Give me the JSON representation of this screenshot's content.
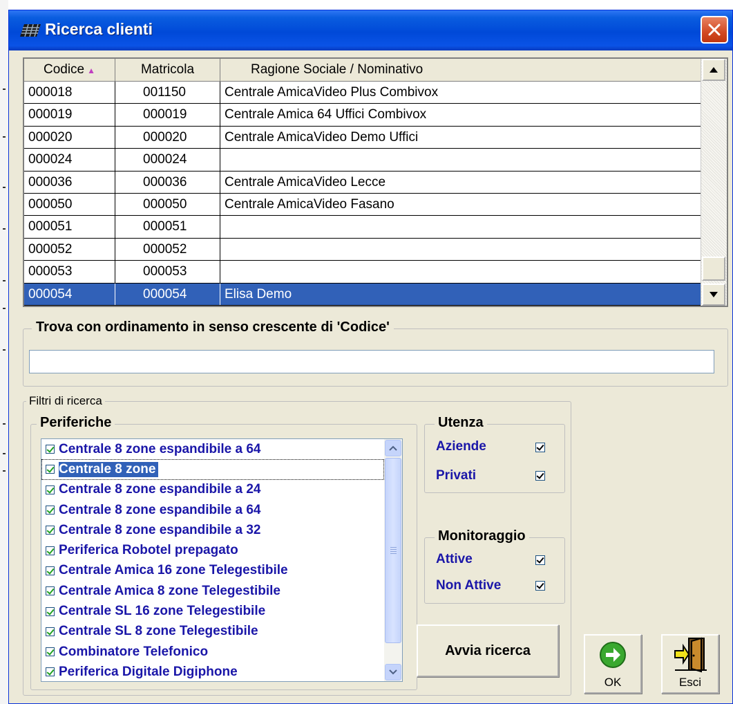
{
  "window": {
    "title": "Ricerca clienti"
  },
  "grid": {
    "columns": [
      {
        "label": "Codice",
        "sort": "ascending"
      },
      {
        "label": "Matricola"
      },
      {
        "label": "Ragione Sociale / Nominativo"
      }
    ],
    "rows": [
      {
        "codice": "000018",
        "matricola": "001150",
        "nome": "Centrale AmicaVideo Plus Combivox"
      },
      {
        "codice": "000019",
        "matricola": "000019",
        "nome": "Centrale Amica 64 Uffici Combivox"
      },
      {
        "codice": "000020",
        "matricola": "000020",
        "nome": "Centrale AmicaVideo Demo Uffici"
      },
      {
        "codice": "000024",
        "matricola": "000024",
        "nome": ""
      },
      {
        "codice": "000036",
        "matricola": "000036",
        "nome": "Centrale AmicaVideo Lecce"
      },
      {
        "codice": "000050",
        "matricola": "000050",
        "nome": "Centrale AmicaVideo Fasano"
      },
      {
        "codice": "000051",
        "matricola": "000051",
        "nome": ""
      },
      {
        "codice": "000052",
        "matricola": "000052",
        "nome": ""
      },
      {
        "codice": "000053",
        "matricola": "000053",
        "nome": ""
      },
      {
        "codice": "000054",
        "matricola": "000054",
        "nome": "Elisa Demo",
        "selected": true
      }
    ],
    "selection_color": "#3161b8"
  },
  "find": {
    "label": "Trova con ordinamento in senso crescente di 'Codice'",
    "value": ""
  },
  "filters": {
    "label": "Filtri di ricerca",
    "periferiche": {
      "label": "Periferiche",
      "items": [
        {
          "label": "Centrale 8 zone espandibile a 64",
          "checked": true
        },
        {
          "label": "Centrale 8 zone",
          "checked": true,
          "selected": true
        },
        {
          "label": "Centrale 8 zone espandibile a 24",
          "checked": true
        },
        {
          "label": "Centrale 8 zone espandibile a 64",
          "checked": true
        },
        {
          "label": "Centrale 8 zone espandibile a 32",
          "checked": true
        },
        {
          "label": "Periferica Robotel prepagato",
          "checked": true
        },
        {
          "label": "Centrale Amica 16 zone Telegestibile",
          "checked": true
        },
        {
          "label": "Centrale Amica 8 zone Telegestibile",
          "checked": true
        },
        {
          "label": "Centrale SL 16 zone Telegestibile",
          "checked": true
        },
        {
          "label": "Centrale SL 8 zone Telegestibile",
          "checked": true
        },
        {
          "label": "Combinatore Telefonico",
          "checked": true
        },
        {
          "label": "Periferica Digitale Digiphone",
          "checked": true
        }
      ]
    },
    "utenza": {
      "label": "Utenza",
      "aziende": {
        "label": "Aziende",
        "checked": true
      },
      "privati": {
        "label": "Privati",
        "checked": true
      }
    },
    "monitoraggio": {
      "label": "Monitoraggio",
      "attive": {
        "label": "Attive",
        "checked": true
      },
      "non_attive": {
        "label": "Non Attive",
        "checked": true
      }
    }
  },
  "buttons": {
    "search": "Avvia ricerca",
    "ok": "OK",
    "exit": "Esci"
  },
  "icons": {
    "title": "grid-icon",
    "close": "close-icon",
    "sort": "sort-up-icon",
    "ok": "green-arrow-right-icon",
    "exit": "exit-door-icon"
  },
  "colors": {
    "titlebar": "#0049d8",
    "window_bg": "#ece9d8",
    "option_text": "#1a16a8",
    "close_btn": "#d24a23"
  }
}
